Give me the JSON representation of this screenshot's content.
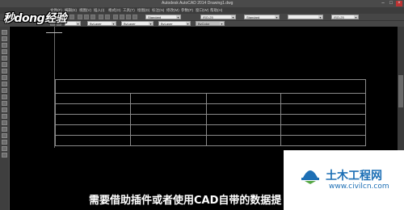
{
  "window": {
    "title": "Autodesk AutoCAD 2014   Drawing1.dwg"
  },
  "menus": [
    "文件(F)",
    "编辑(E)",
    "视图(V)",
    "插入(I)",
    "格式(O)",
    "工具(T)",
    "绘图(D)",
    "标注(N)",
    "修改(M)",
    "参数(P)",
    "窗口(W)",
    "帮助(H)"
  ],
  "toolbar": {
    "text_style": "Standard",
    "dim_style": "ISO-25",
    "table_style": "Standard",
    "multileader_style": "ISO-25",
    "layer": "ByLayer",
    "color": "ByLayer",
    "linetype": "ByLayer",
    "lineweight": "ByLayer",
    "plot_style": "ByColor"
  },
  "watermark": {
    "logo": "秒dong经验"
  },
  "subtitle": "需要借助插件或者使用CAD自带的数据提",
  "site_logo": {
    "brand": "土木工程网",
    "url": "www.civilcn.com"
  }
}
